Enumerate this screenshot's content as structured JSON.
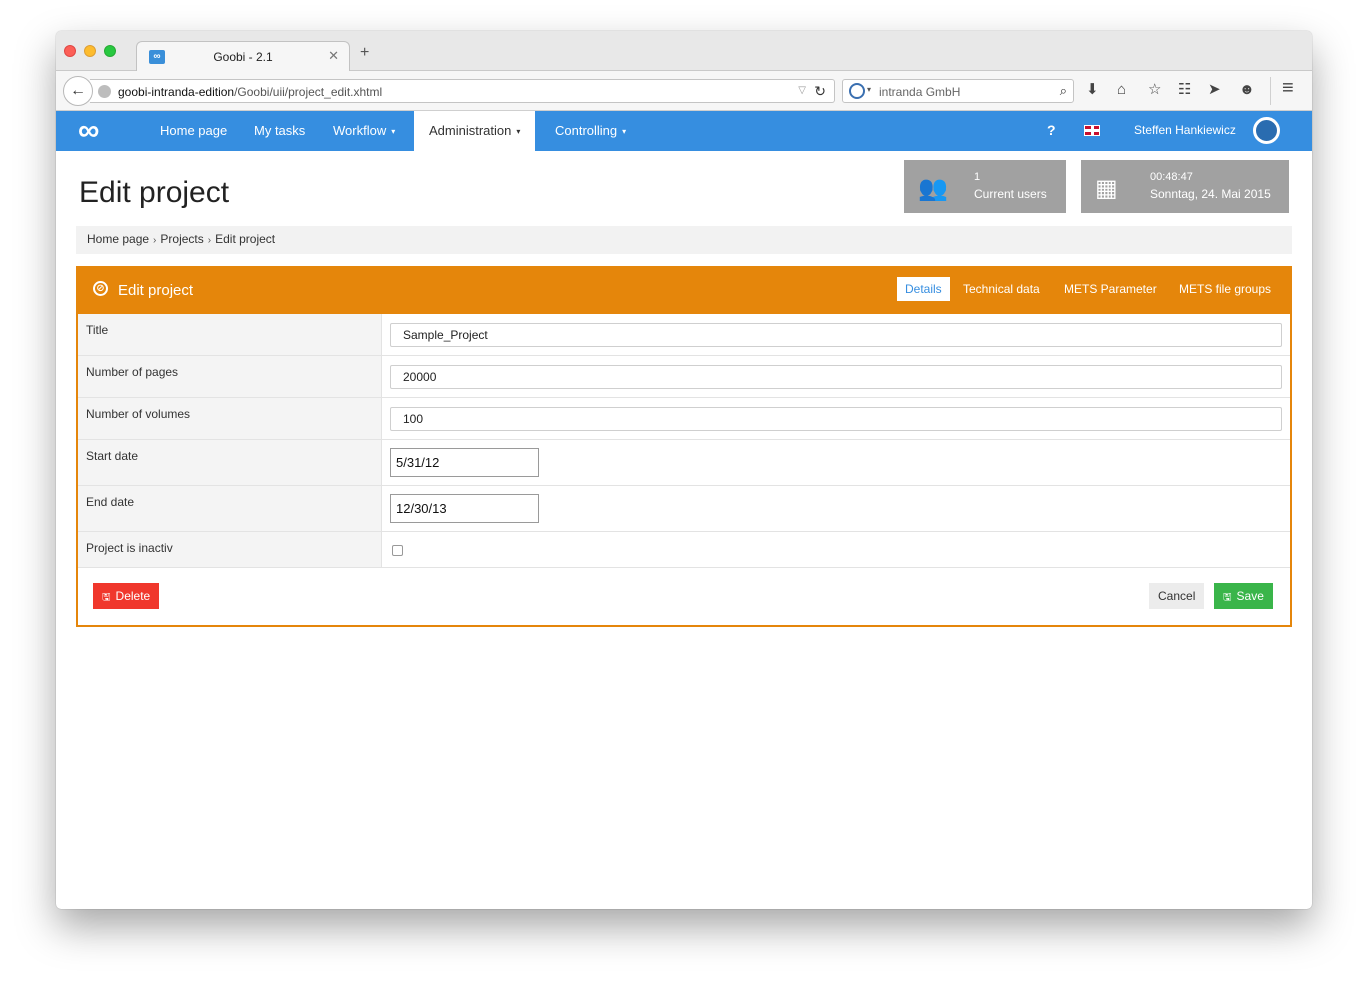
{
  "browser": {
    "tab_title": "Goobi - 2.1",
    "tab_favicon": "∞",
    "tab_close": "✕",
    "new_tab": "+",
    "back": "←",
    "url_host": "goobi-intranda-edition",
    "url_path": "/Goobi/uii/project_edit.xhtml",
    "url_dropdown": "▽",
    "reload": "↻",
    "search_caret": "▾",
    "search_text": "intranda GmbH",
    "search_glyph": "⌕",
    "toolbar_icons": {
      "download": "⬇",
      "home": "⌂",
      "bookmark": "☆",
      "reading_list": "☷",
      "send": "➤",
      "chat": "☻",
      "menu": "≡"
    }
  },
  "app": {
    "logo": "∞",
    "nav": {
      "home": "Home page",
      "tasks": "My tasks",
      "workflow": "Workflow",
      "administration": "Administration",
      "controlling": "Controlling",
      "caret": "▾",
      "help": "?",
      "user": "Steffen Hankiewicz"
    }
  },
  "page": {
    "title": "Edit project",
    "widgets": {
      "users_count": "1",
      "users_label": "Current users",
      "time": "00:48:47",
      "date": "Sonntag, 24. Mai 2015",
      "users_glyph": "👥",
      "calendar_glyph": "▦"
    },
    "breadcrumb": [
      "Home page",
      "Projects",
      "Edit project"
    ],
    "breadcrumb_sep": "›"
  },
  "panel": {
    "title": "Edit project",
    "icon_glyph": "⊘",
    "tabs": [
      "Details",
      "Technical data",
      "METS Parameter",
      "METS file groups"
    ],
    "fields": {
      "title_label": "Title",
      "title_value": "Sample_Project",
      "pages_label": "Number of pages",
      "pages_value": "20000",
      "volumes_label": "Number of volumes",
      "volumes_value": "100",
      "start_label": "Start date",
      "start_value": "5/31/12",
      "end_label": "End date",
      "end_value": "12/30/13",
      "inactive_label": "Project is inactiv"
    },
    "buttons": {
      "delete": "Delete",
      "cancel": "Cancel",
      "save": "Save",
      "disk_glyph": "🖫"
    }
  },
  "colors": {
    "app_blue": "#368ee0",
    "panel_orange": "#e5860b",
    "delete_red": "#f0372c",
    "save_green": "#3ab54a",
    "widget_gray": "#a1a1a1"
  }
}
